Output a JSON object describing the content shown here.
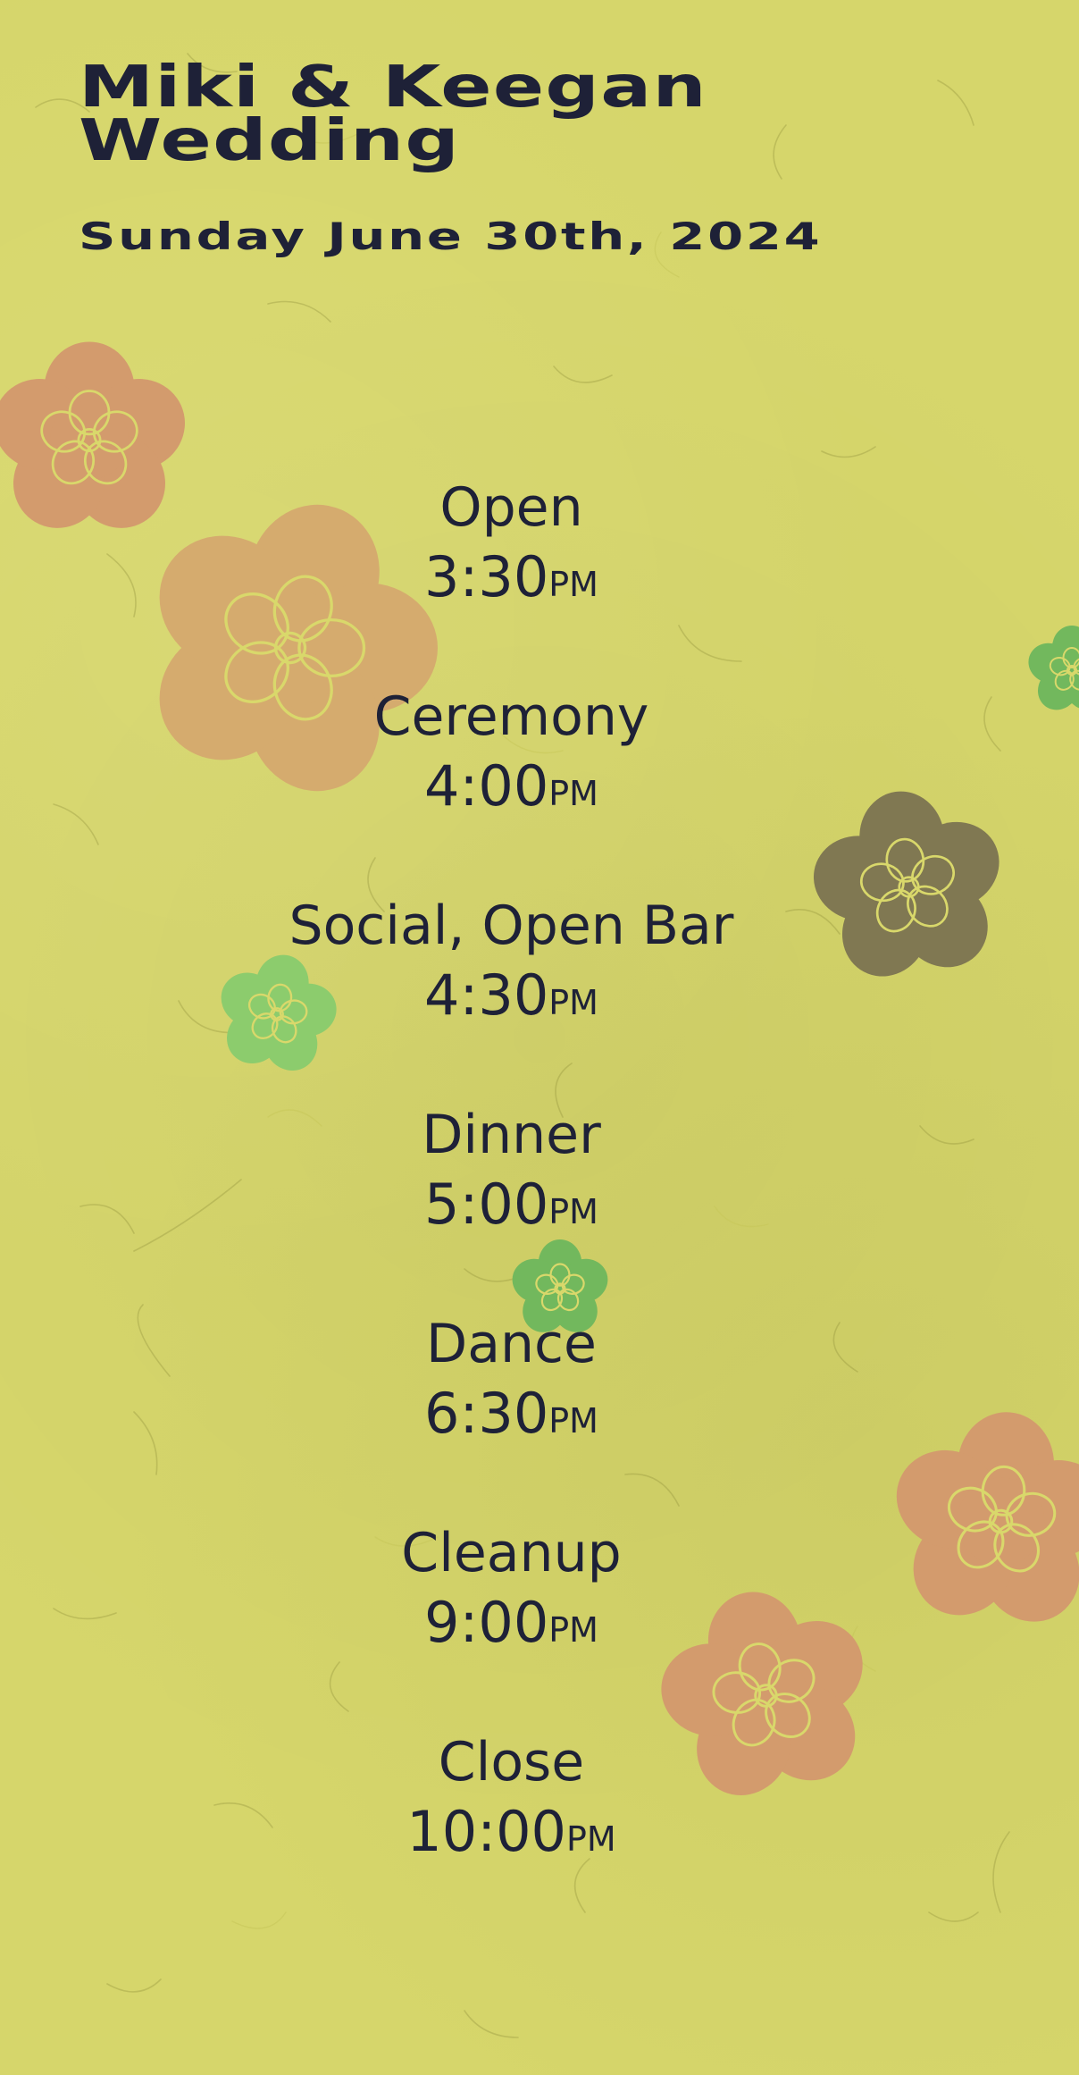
{
  "header": {
    "title": "Miki & Keegan Wedding",
    "date": "Sunday June 30th, 2024"
  },
  "schedule": [
    {
      "name": "Open",
      "time": "3:30",
      "ampm": "PM"
    },
    {
      "name": "Ceremony",
      "time": "4:00",
      "ampm": "PM"
    },
    {
      "name": "Social, Open Bar",
      "time": "4:30",
      "ampm": "PM"
    },
    {
      "name": "Dinner",
      "time": "5:00",
      "ampm": "PM"
    },
    {
      "name": "Dance",
      "time": "6:30",
      "ampm": "PM"
    },
    {
      "name": "Cleanup",
      "time": "9:00",
      "ampm": "PM"
    },
    {
      "name": "Close",
      "time": "10:00",
      "ampm": "PM"
    }
  ],
  "decor": {
    "background_color": "#d6d66b",
    "text_color": "#1e2137",
    "flower_icon": "flower-icon",
    "flower_colors": {
      "orange": "#d39b6d",
      "peach": "#d5ab6e",
      "green": "#72b85d",
      "light_green": "#8ccc6d",
      "olive": "#807852",
      "outline": "#d9d86b"
    }
  }
}
